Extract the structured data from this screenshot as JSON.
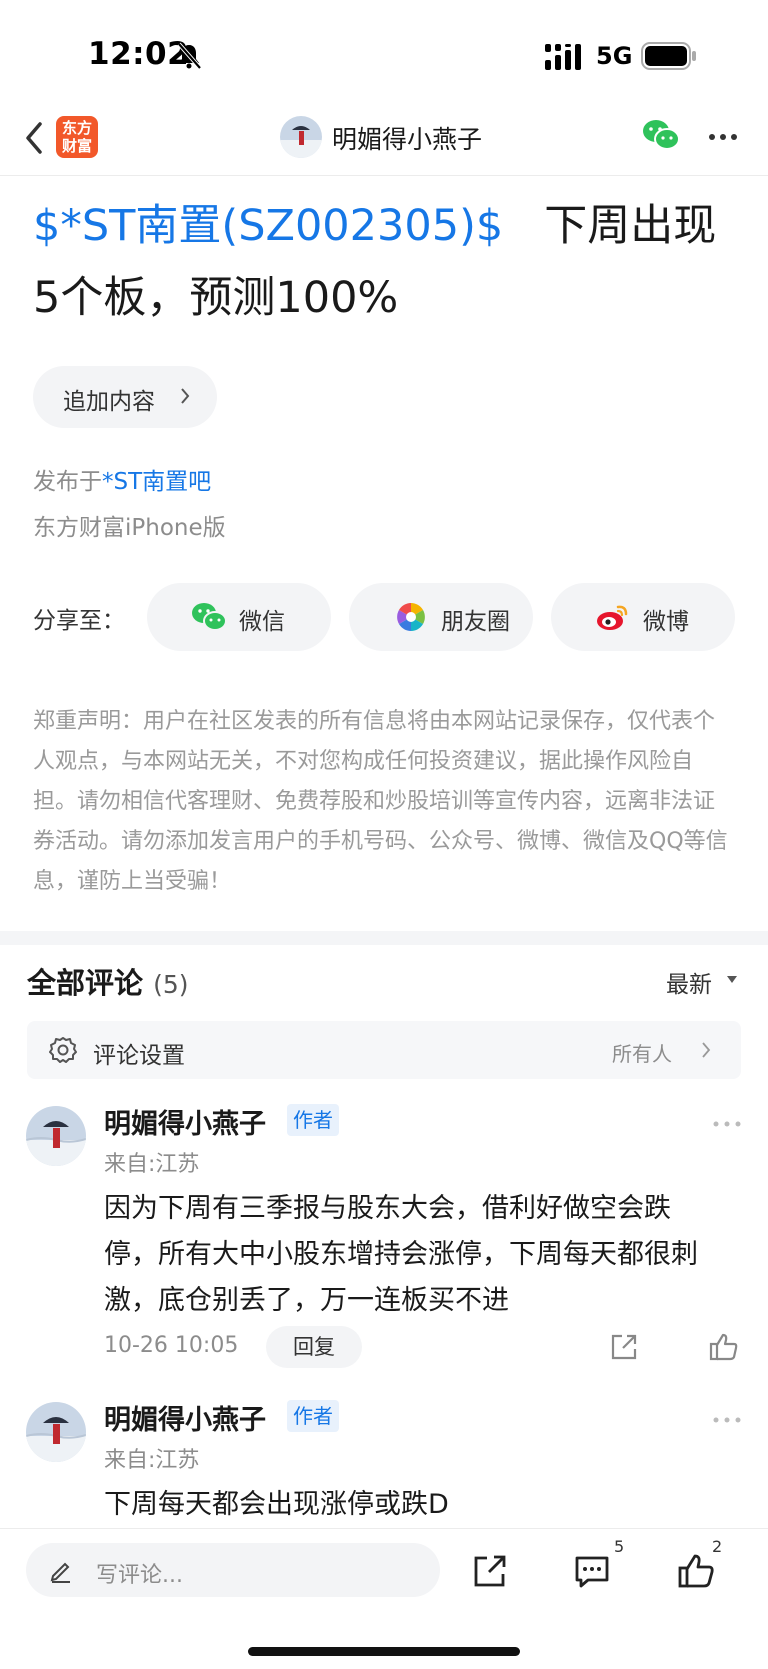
{
  "status_bar": {
    "time": "12:02",
    "network": "5G"
  },
  "nav": {
    "app_logo": "东方\n财富",
    "title": "明媚得小燕子"
  },
  "post": {
    "stock_tag": "$*ST南置(SZ002305)$",
    "title_rest_line1": "下周出现",
    "title_line2": "5个板，预测100%",
    "append_label": "追加内容",
    "posted_prefix": "发布于",
    "bar_name": "*ST南置吧",
    "device": "东方财富iPhone版"
  },
  "share": {
    "label": "分享至：",
    "buttons": [
      {
        "label": "微信",
        "icon": "wechat-icon"
      },
      {
        "label": "朋友圈",
        "icon": "moments-icon"
      },
      {
        "label": "微博",
        "icon": "weibo-icon"
      }
    ]
  },
  "disclaimer": "郑重声明：用户在社区发表的所有信息将由本网站记录保存，仅代表个人观点，与本网站无关，不对您构成任何投资建议，据此操作风险自担。请勿相信代客理财、免费荐股和炒股培训等宣传内容，远离非法证券活动。请勿添加发言用户的手机号码、公众号、微博、微信及QQ等信息，谨防上当受骗！",
  "comments_section": {
    "title": "全部评论",
    "count": "(5)",
    "sort": "最新",
    "settings_label": "评论设置",
    "settings_value": "所有人"
  },
  "comments": [
    {
      "author": "明媚得小燕子",
      "badge": "作者",
      "location": "来自:江苏",
      "content": "因为下周有三季报与股东大会，借利好做空会跌停，所有大中小股东增持会涨停，下周每天都很刺激，底仓别丢了，万一连板买不进",
      "time": "10-26 10:05",
      "reply": "回复"
    },
    {
      "author": "明媚得小燕子",
      "badge": "作者",
      "location": "来自:江苏",
      "content": "下周每天都会出现涨停或跌D"
    }
  ],
  "bottom_bar": {
    "placeholder": "写评论...",
    "comment_count": "5",
    "like_count": "2"
  },
  "colors": {
    "link": "#1677e6",
    "brand": "#f2582a",
    "wechat": "#2fc25b"
  }
}
